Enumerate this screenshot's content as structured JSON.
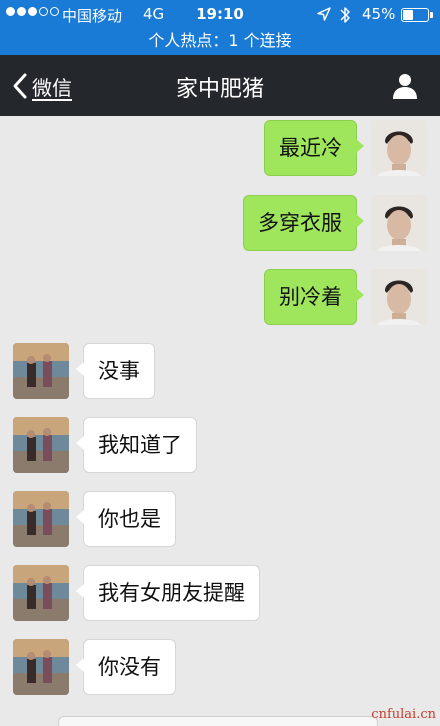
{
  "status_bar": {
    "carrier": "中国移动",
    "network": "4G",
    "time": "19:10",
    "battery_percent": "45%",
    "battery_level": 0.45
  },
  "hotspot": {
    "text": "个人热点：1 个连接"
  },
  "nav": {
    "back_label": "微信",
    "title": "家中肥猪",
    "icons": [
      "chevron-left-icon",
      "person-icon"
    ]
  },
  "messages": [
    {
      "side": "right",
      "text": "最近冷"
    },
    {
      "side": "right",
      "text": "多穿衣服"
    },
    {
      "side": "right",
      "text": "别冷着"
    },
    {
      "side": "left",
      "text": "没事"
    },
    {
      "side": "left",
      "text": "我知道了"
    },
    {
      "side": "left",
      "text": "你也是"
    },
    {
      "side": "left",
      "text": "我有女朋友提醒"
    },
    {
      "side": "left",
      "text": "你没有"
    }
  ],
  "watermark": "cnfulai.cn",
  "colors": {
    "status_bar_bg": "#1a7bd6",
    "nav_bg": "#24272c",
    "chat_bg": "#e9e9ea",
    "outgoing_bubble": "#9fe65c",
    "incoming_bubble": "#ffffff"
  }
}
